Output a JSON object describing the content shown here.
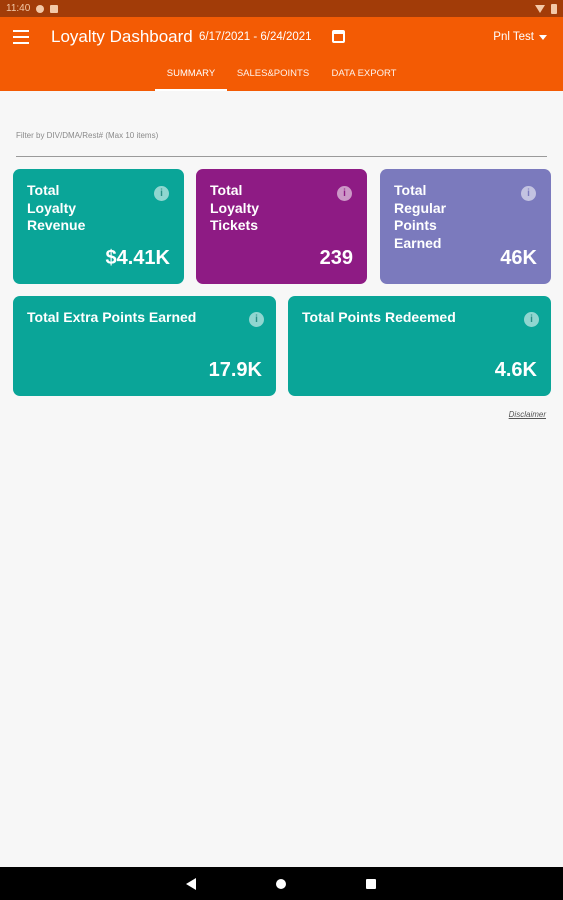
{
  "status_bar": {
    "time": "11:40"
  },
  "appbar": {
    "title": "Loyalty Dashboard",
    "date_range": "6/17/2021 - 6/24/2021",
    "user": "Pnl Test",
    "color": "#f35b04"
  },
  "tabs": [
    {
      "label": "SUMMARY",
      "active": true
    },
    {
      "label": "SALES&POINTS",
      "active": false
    },
    {
      "label": "DATA EXPORT",
      "active": false
    }
  ],
  "filter": {
    "placeholder": "Filter by DIV/DMA/Rest# (Max 10 items)"
  },
  "cards": [
    {
      "label": "Total Loyalty Revenue",
      "value": "$4.41K",
      "color": "#0aa598"
    },
    {
      "label": "Total Loyalty Tickets",
      "value": "239",
      "color": "#8e1b84"
    },
    {
      "label": "Total Regular Points Earned",
      "value": "46K",
      "color": "#7b7abd"
    },
    {
      "label": "Total Extra Points Earned",
      "value": "17.9K",
      "color": "#0aa598"
    },
    {
      "label": "Total Points Redeemed",
      "value": "4.6K",
      "color": "#0aa598"
    }
  ],
  "info_glyph": "i",
  "disclaimer": "Disclaimer"
}
